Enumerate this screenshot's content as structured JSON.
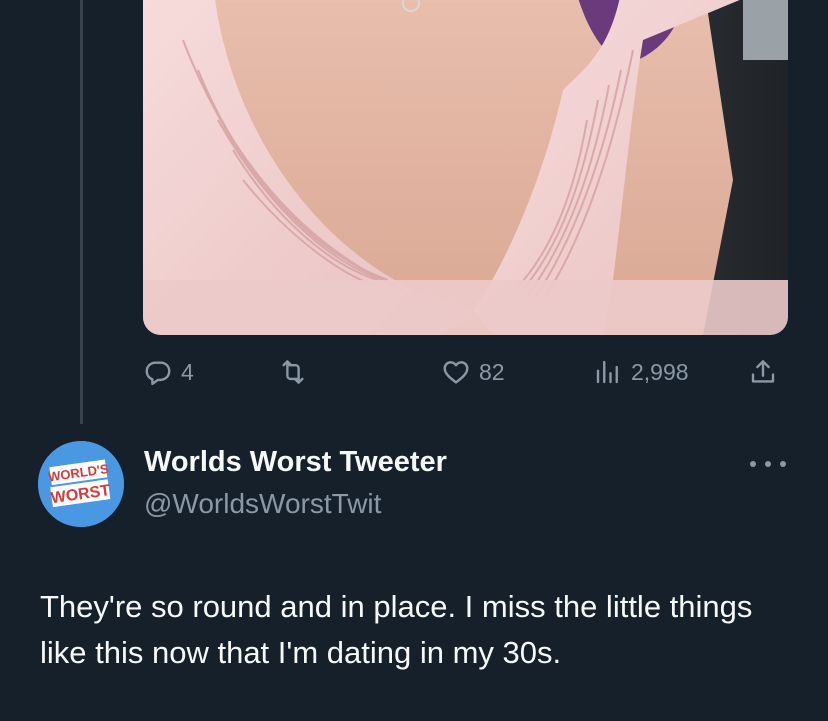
{
  "previous_tweet": {
    "media": {
      "description_icon": "photo-image",
      "colors": {
        "dress": "#f3cfcf",
        "skin": "#e8b9a5",
        "hair": "#6b3a7d",
        "background": "#2f3338"
      }
    },
    "actions": {
      "reply_count": "4",
      "retweet_count": "",
      "like_count": "82",
      "view_count": "2,998"
    }
  },
  "tweet": {
    "display_name": "Worlds Worst Tweeter",
    "handle": "@WorldsWorstTwit",
    "avatar_text_top": "WORLD'S",
    "avatar_text_bottom": "WORST",
    "text": "They're so round and in place. I miss the little things like this now that I'm dating in my 30s."
  },
  "colors": {
    "background": "#15202b",
    "secondary_text": "#8b98a5",
    "avatar_bg": "#4a97e2",
    "thread_line": "#38444d"
  }
}
